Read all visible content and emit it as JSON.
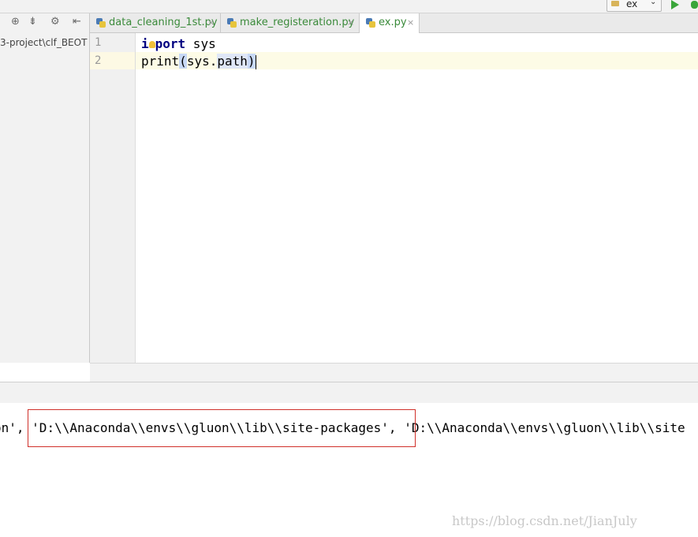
{
  "toolbar": {
    "run_config_label": "ex"
  },
  "project_panel": {
    "path_label": "3-project\\clf_BEOT"
  },
  "tabs": [
    {
      "label": "data_cleaning_1st.py",
      "close": "×",
      "color": "#3a8a3a"
    },
    {
      "label": "make_registeration.py",
      "close": "×",
      "color": "#3a8a3a"
    },
    {
      "label": "ex.py",
      "close": "×",
      "color": "#3a8a3a",
      "active": true
    }
  ],
  "editor": {
    "line_numbers": [
      "1",
      "2"
    ],
    "line1": {
      "kw_start": "i",
      "kw_end": "port",
      "rest": " sys"
    },
    "line2": {
      "fn": "print",
      "open": "(",
      "arg_a": "sys.",
      "arg_b": "path",
      "close": ")"
    }
  },
  "console": {
    "prefix": "on', ",
    "highlighted": "'D:\\\\Anaconda\\\\envs\\\\gluon\\\\lib\\\\site-packages'",
    "suffix": ", 'D:\\\\Anaconda\\\\envs\\\\gluon\\\\lib\\\\site"
  },
  "watermark": "https://blog.csdn.net/JianJuly",
  "colors": {
    "accent_green": "#3aa53a",
    "highlight_red": "#d0302a",
    "keyword": "#000080"
  }
}
